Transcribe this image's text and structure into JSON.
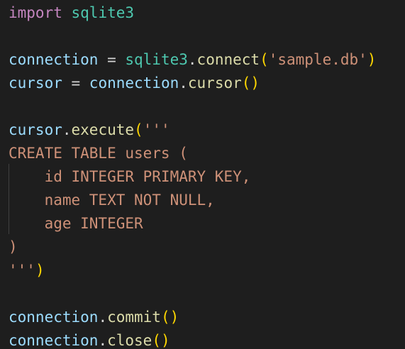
{
  "code": {
    "line1": {
      "kw": "import",
      "mod": "sqlite3"
    },
    "line3": {
      "var": "connection",
      "op": " = ",
      "mod": "sqlite3",
      "dot": ".",
      "fn": "connect",
      "lparen": "(",
      "str": "'sample.db'",
      "rparen": ")"
    },
    "line4": {
      "var": "cursor",
      "op": " = ",
      "var2": "connection",
      "dot": ".",
      "fn": "cursor",
      "parens": "()"
    },
    "line6": {
      "var": "cursor",
      "dot": ".",
      "fn": "execute",
      "lparen": "(",
      "str": "'''"
    },
    "line7": {
      "str": "CREATE TABLE users ("
    },
    "line8": {
      "str": "    id INTEGER PRIMARY KEY,"
    },
    "line9": {
      "str": "    name TEXT NOT NULL,"
    },
    "line10": {
      "str": "    age INTEGER"
    },
    "line11": {
      "str": ")"
    },
    "line12": {
      "str": "'''",
      "rparen": ")"
    },
    "line14": {
      "var": "connection",
      "dot": ".",
      "fn": "commit",
      "parens": "()"
    },
    "line15": {
      "var": "connection",
      "dot": ".",
      "fn": "close",
      "parens": "()"
    }
  },
  "colors": {
    "background": "#1e1e1e",
    "keyword": "#c586c0",
    "module": "#4ec9b0",
    "variable": "#9cdcfe",
    "function": "#dcdcaa",
    "string": "#ce9178",
    "bracket": "#ffd700"
  }
}
